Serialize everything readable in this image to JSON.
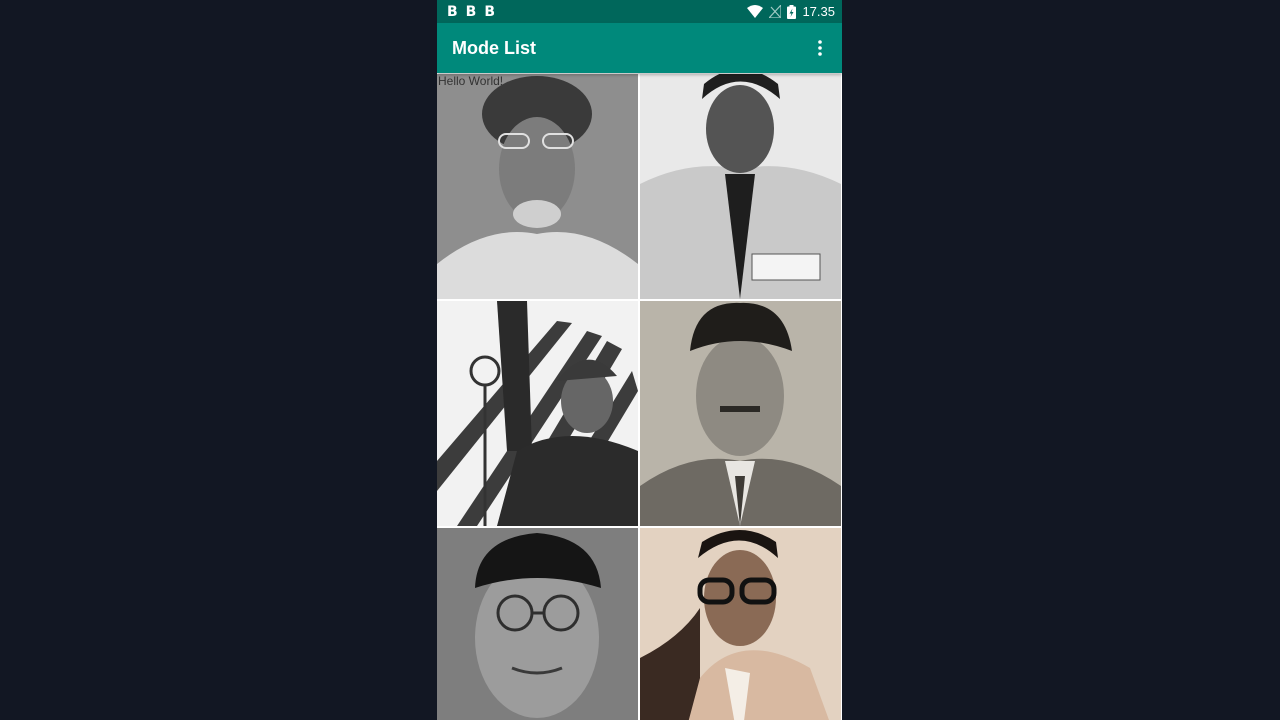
{
  "status_bar": {
    "notification_icons": [
      "B",
      "B",
      "B"
    ],
    "time": "17.35",
    "icons": [
      "wifi-icon",
      "signal-icon",
      "battery-icon"
    ]
  },
  "app_bar": {
    "title": "Mode List",
    "overflow_icon": "more-vert-icon"
  },
  "content": {
    "hello_text": "Hello World!"
  },
  "grid": {
    "tiles": [
      {
        "name": "portrait-1"
      },
      {
        "name": "portrait-2"
      },
      {
        "name": "portrait-3"
      },
      {
        "name": "portrait-4"
      },
      {
        "name": "portrait-5"
      },
      {
        "name": "portrait-6"
      }
    ]
  },
  "colors": {
    "status_bar": "#00675b",
    "app_bar": "#00897b",
    "background": "#121723"
  }
}
